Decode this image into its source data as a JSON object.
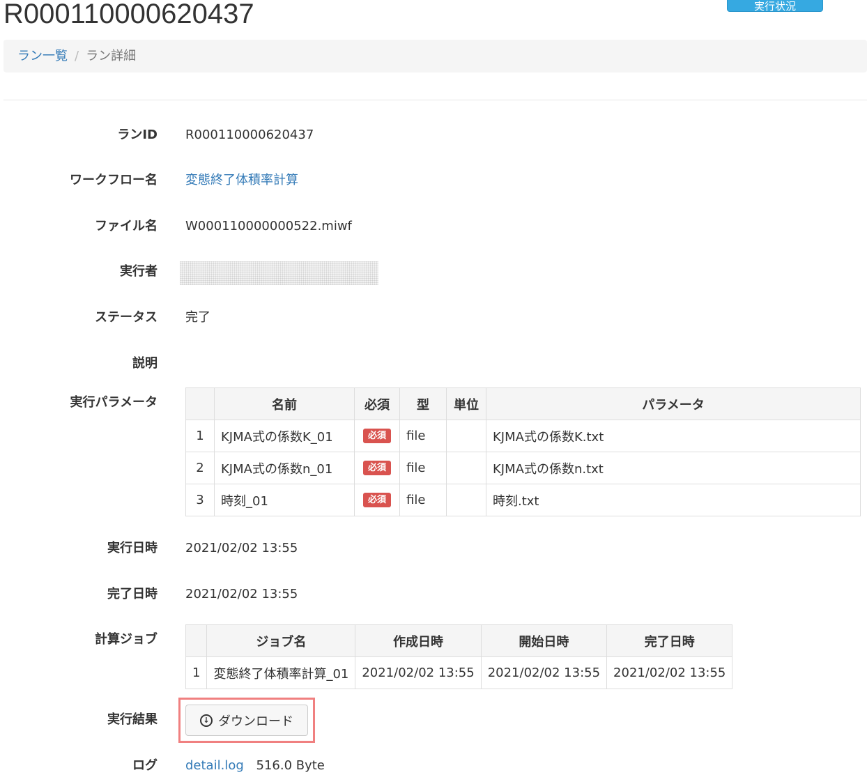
{
  "header": {
    "title": "R000110000620437",
    "top_button_label": "実行状況"
  },
  "breadcrumb": {
    "items": [
      "ラン一覧",
      "ラン詳細"
    ],
    "separator": "/"
  },
  "detail": {
    "run_id_label": "ランID",
    "run_id": "R000110000620437",
    "workflow_label": "ワークフロー名",
    "workflow": "変態終了体積率計算",
    "file_label": "ファイル名",
    "file": "W000110000000522.miwf",
    "executor_label": "実行者",
    "status_label": "ステータス",
    "status": "完了",
    "description_label": "説明",
    "params_label": "実行パラメータ",
    "exec_datetime_label": "実行日時",
    "exec_datetime": "2021/02/02 13:55",
    "done_datetime_label": "完了日時",
    "done_datetime": "2021/02/02 13:55",
    "jobs_label": "計算ジョブ",
    "result_label": "実行結果",
    "download_label": "ダウンロード",
    "log_label": "ログ",
    "log_link": "detail.log",
    "log_size": "516.0 Byte"
  },
  "params_table": {
    "headers": [
      "",
      "名前",
      "必須",
      "型",
      "単位",
      "パラメータ"
    ],
    "rows": [
      {
        "no": "1",
        "name": "KJMA式の係数K_01",
        "required": "必須",
        "type": "file",
        "unit": "",
        "param": "KJMA式の係数K.txt"
      },
      {
        "no": "2",
        "name": "KJMA式の係数n_01",
        "required": "必須",
        "type": "file",
        "unit": "",
        "param": "KJMA式の係数n.txt"
      },
      {
        "no": "3",
        "name": "時刻_01",
        "required": "必須",
        "type": "file",
        "unit": "",
        "param": "時刻.txt"
      }
    ]
  },
  "jobs_table": {
    "headers": [
      "",
      "ジョブ名",
      "作成日時",
      "開始日時",
      "完了日時"
    ],
    "rows": [
      {
        "no": "1",
        "name": "変態終了体積率計算_01",
        "created": "2021/02/02 13:55",
        "started": "2021/02/02 13:55",
        "finished": "2021/02/02 13:55"
      }
    ]
  },
  "colors": {
    "link": "#337ab7",
    "required_badge": "#d9534f",
    "highlight": "#f08080",
    "top_button": "#36a9e1"
  }
}
